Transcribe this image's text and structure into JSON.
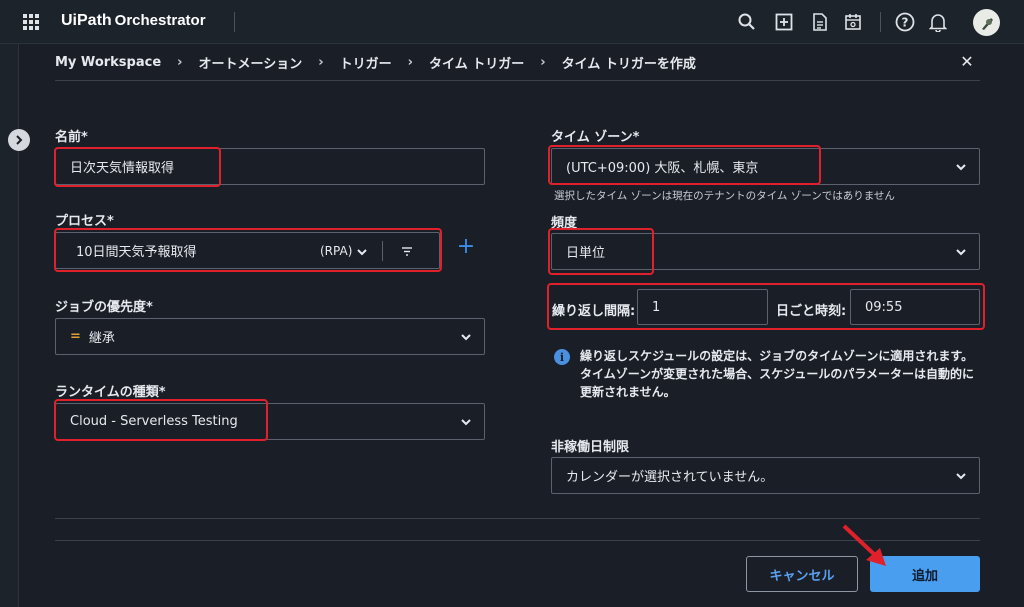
{
  "app": {
    "brand": "UiPath",
    "product": "Orchestrator"
  },
  "breadcrumb": [
    "My Workspace",
    "オートメーション",
    "トリガー",
    "タイム トリガー",
    "タイム トリガーを作成"
  ],
  "form": {
    "name": {
      "label": "名前*",
      "value": "日次天気情報取得"
    },
    "process": {
      "label": "プロセス*",
      "value": "10日間天気予報取得",
      "type": "(RPA)"
    },
    "priority": {
      "label": "ジョブの優先度*",
      "symbol": "=",
      "value": "継承"
    },
    "runtime": {
      "label": "ランタイムの種類*",
      "value": "Cloud - Serverless Testing"
    },
    "timezone": {
      "label": "タイム ゾーン*",
      "value": "(UTC+09:00) 大阪、札幌、東京",
      "hint": "選択したタイム ゾーンは現在のテナントのタイム ゾーンではありません"
    },
    "frequency": {
      "label": "頻度",
      "value": "日単位"
    },
    "interval": {
      "label": "繰り返し間隔:",
      "value": "1",
      "time_label": "日ごと時刻:",
      "time_value": "09:55"
    },
    "info": "繰り返しスケジュールの設定は、ジョブのタイムゾーンに適用されます。タイムゾーンが変更された場合、スケジュールのパラメーターは自動的に更新されません。",
    "nonworking": {
      "label": "非稼働日制限",
      "value": "カレンダーが選択されていません。"
    }
  },
  "buttons": {
    "cancel": "キャンセル",
    "add": "追加"
  },
  "colors": {
    "accent": "#4a9ef0",
    "highlight": "#e0202a",
    "background": "#1a1f27"
  },
  "icons": [
    "apps-grid-icon",
    "search-icon",
    "add-square-icon",
    "document-icon",
    "calendar-icon",
    "help-icon",
    "bell-icon",
    "avatar",
    "chevron-right-icon",
    "close-icon",
    "chevron-down-icon",
    "filter-icon",
    "plus-icon",
    "info-icon"
  ]
}
